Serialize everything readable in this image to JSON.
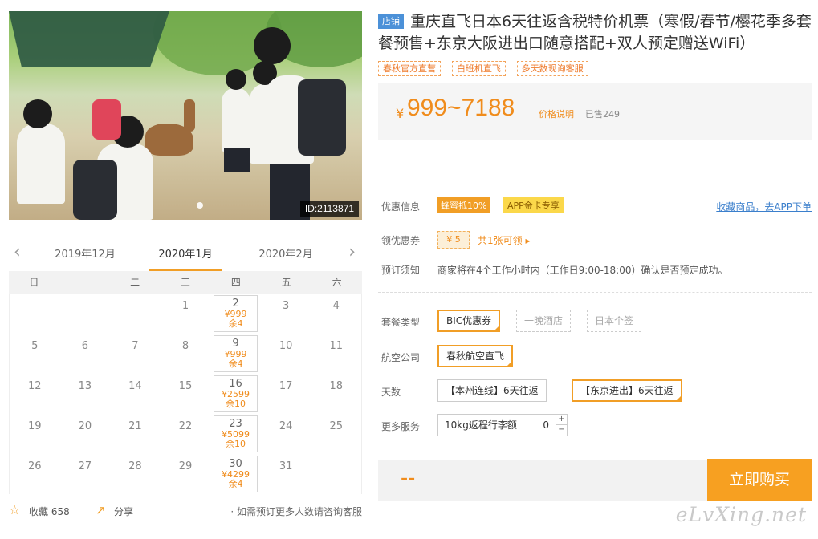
{
  "photo": {
    "id_label": "ID:2113871"
  },
  "calendar": {
    "prev_month": "2019年12月",
    "current_month": "2020年1月",
    "next_month": "2020年2月",
    "weekdays": [
      "日",
      "一",
      "二",
      "三",
      "四",
      "五",
      "六"
    ],
    "weeks": [
      [
        {
          "d": ""
        },
        {
          "d": ""
        },
        {
          "d": ""
        },
        {
          "d": "1"
        },
        {
          "d": "2",
          "price": "¥999",
          "left": "余4"
        },
        {
          "d": "3"
        },
        {
          "d": "4"
        }
      ],
      [
        {
          "d": "5"
        },
        {
          "d": "6"
        },
        {
          "d": "7"
        },
        {
          "d": "8"
        },
        {
          "d": "9",
          "price": "¥999",
          "left": "余4"
        },
        {
          "d": "10"
        },
        {
          "d": "11"
        }
      ],
      [
        {
          "d": "12"
        },
        {
          "d": "13"
        },
        {
          "d": "14"
        },
        {
          "d": "15"
        },
        {
          "d": "16",
          "price": "¥2599",
          "left": "余10"
        },
        {
          "d": "17"
        },
        {
          "d": "18"
        }
      ],
      [
        {
          "d": "19"
        },
        {
          "d": "20"
        },
        {
          "d": "21"
        },
        {
          "d": "22"
        },
        {
          "d": "23",
          "price": "¥5099",
          "left": "余10"
        },
        {
          "d": "24"
        },
        {
          "d": "25"
        }
      ],
      [
        {
          "d": "26"
        },
        {
          "d": "27"
        },
        {
          "d": "28"
        },
        {
          "d": "29"
        },
        {
          "d": "30",
          "price": "¥4299",
          "left": "余4"
        },
        {
          "d": "31"
        },
        {
          "d": ""
        }
      ]
    ]
  },
  "bottom": {
    "favorite_label": "收藏 658",
    "share_label": "分享",
    "note": "· 如需预订更多人数请咨询客服"
  },
  "product": {
    "shop_tag": "店铺",
    "title": "重庆直飞日本6天往返含税特价机票（寒假/春节/樱花季多套餐预售+东京大阪进出口随意搭配+双人预定赠送WiFi）",
    "tags": [
      "春秋官方直营",
      "白班机直飞",
      "多天数现询客服"
    ]
  },
  "price": {
    "yen": "¥",
    "amount": "999~7188",
    "explain": "价格说明",
    "sold": "已售249"
  },
  "promo": {
    "label": "优惠信息",
    "badge1": "蜂蜜抵10%",
    "badge2": "APP金卡专享",
    "fav_link": "收藏商品，去APP下单"
  },
  "coupon": {
    "label": "领优惠券",
    "value": "¥ 5",
    "link": "共1张可领 ▸"
  },
  "notice": {
    "label": "预订须知",
    "text": "商家将在4个工作小时内（工作日9:00-18:00）确认是否预定成功。"
  },
  "options": {
    "type_label": "套餐类型",
    "types": [
      "BIC优惠券",
      "一晚酒店",
      "日本个签"
    ],
    "airline_label": "航空公司",
    "airline": "春秋航空直飞",
    "days_label": "天数",
    "days": [
      "【本州连线】6天往返",
      "【东京进出】6天往返"
    ],
    "more_label": "更多服务",
    "service_label": "10kg返程行李额",
    "service_qty": "0",
    "plus": "+",
    "minus": "−"
  },
  "buy": {
    "total": "--",
    "button": "立即购买"
  },
  "watermark": "eLvXing.net",
  "colors": {
    "accent": "#f19e26",
    "price": "#f08c1c",
    "link": "#3b7fcc",
    "shop_tag": "#4c91d8"
  }
}
